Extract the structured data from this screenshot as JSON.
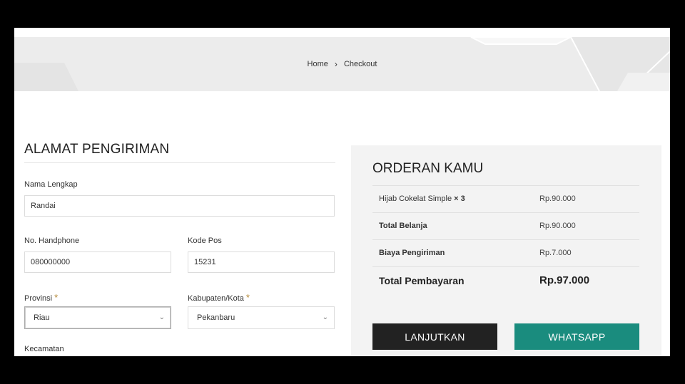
{
  "breadcrumb": {
    "home": "Home",
    "separator": "›",
    "current": "Checkout"
  },
  "shipping": {
    "title": "ALAMAT PENGIRIMAN",
    "required_mark": "*",
    "name": {
      "label": "Nama Lengkap",
      "value": "Randai"
    },
    "phone": {
      "label": "No. Handphone",
      "value": "080000000"
    },
    "postal": {
      "label": "Kode Pos",
      "value": "15231"
    },
    "province": {
      "label": "Provinsi",
      "value": "Riau"
    },
    "city": {
      "label": "Kabupaten/Kota",
      "value": "Pekanbaru"
    },
    "district": {
      "label": "Kecamatan"
    }
  },
  "order": {
    "title": "ORDERAN KAMU",
    "item": {
      "name": "Hijab Cokelat Simple",
      "qty": "× 3",
      "price": "Rp.90.000"
    },
    "subtotal": {
      "label": "Total Belanja",
      "value": "Rp.90.000"
    },
    "shipping_cost": {
      "label": "Biaya Pengiriman",
      "value": "Rp.7.000"
    },
    "total": {
      "label": "Total Pembayaran",
      "value": "Rp.97.000"
    }
  },
  "buttons": {
    "continue": "LANJUTKAN",
    "whatsapp": "WHATSAPP"
  },
  "colors": {
    "whatsapp": "#1a8c7e",
    "continue": "#222222",
    "required": "#b58a3a"
  }
}
